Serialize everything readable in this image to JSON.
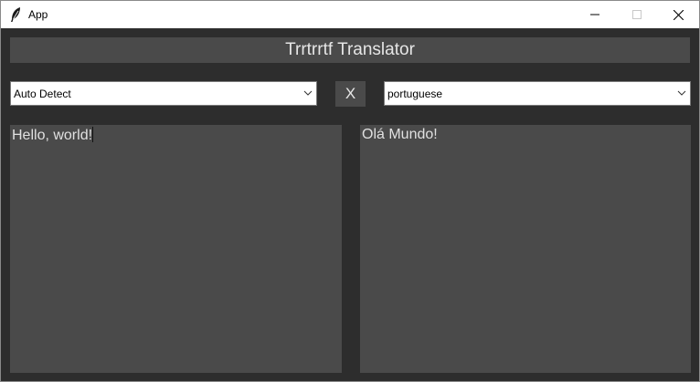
{
  "window": {
    "title": "App",
    "icon": "feather-icon"
  },
  "header": {
    "title": "Trrtrrtf Translator"
  },
  "source_language": {
    "selected": "Auto Detect"
  },
  "swap_button": {
    "label": "X"
  },
  "target_language": {
    "selected": "portuguese"
  },
  "input_text": {
    "value": "Hello, world!"
  },
  "output_text": {
    "value": "Olá Mundo!"
  },
  "colors": {
    "background": "#2d2d2d",
    "panel": "#4a4a4a",
    "text": "#e0e0e0"
  }
}
